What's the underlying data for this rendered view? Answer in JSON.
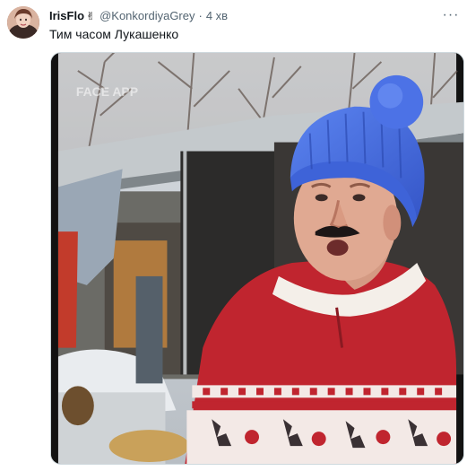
{
  "tweet": {
    "display_name": "IrisFlo",
    "badge_icon": "victory-hand-emoji",
    "badge_glyph": "✌",
    "handle": "@KonkordiyaGrey",
    "separator": "·",
    "timestamp": "4 хв",
    "more_icon": "more-icon",
    "more_glyph": "···",
    "text": "Тим часом Лукашенко",
    "media": {
      "watermark": "FACE APP"
    }
  },
  "colors": {
    "text_primary": "#0f1419",
    "text_secondary": "#536471",
    "hat_blue": "#4a6fe0",
    "sweater_red": "#c0252f"
  }
}
